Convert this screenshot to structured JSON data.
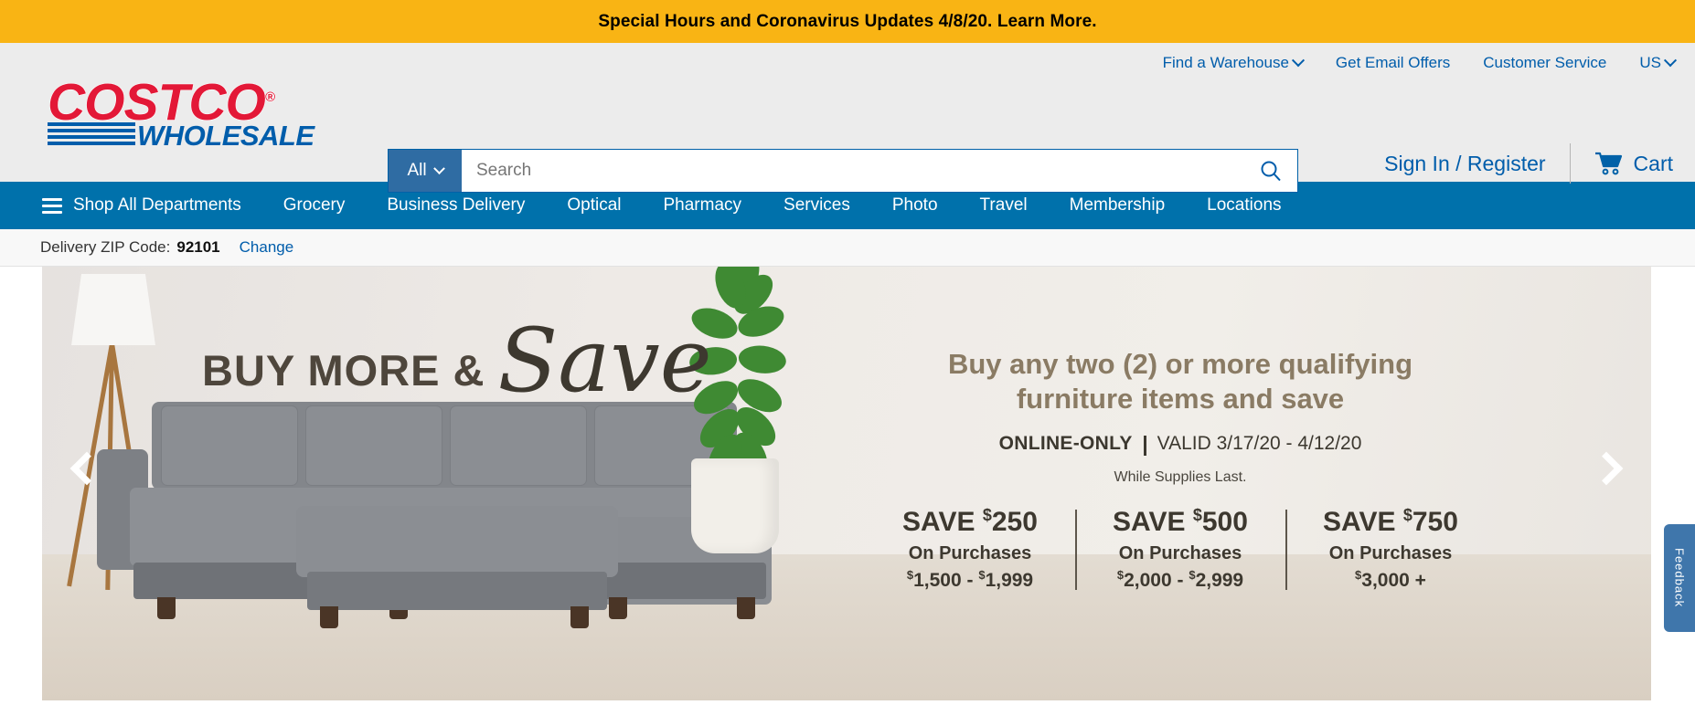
{
  "alert_banner": {
    "text": "Special Hours and Coronavirus Updates 4/8/20. Learn More."
  },
  "header": {
    "logo": {
      "primary": "COSTCO",
      "registered": "®",
      "secondary": "WHOLESALE"
    },
    "top_links": [
      {
        "label": "Find a Warehouse",
        "has_caret": true
      },
      {
        "label": "Get Email Offers",
        "has_caret": false
      },
      {
        "label": "Customer Service",
        "has_caret": false
      },
      {
        "label": "US",
        "has_caret": true
      }
    ],
    "search": {
      "scope": "All",
      "value": "",
      "placeholder": "Search",
      "icon": "search-icon"
    },
    "account": {
      "sign_in": "Sign In / Register",
      "cart_label": "Cart",
      "cart_icon": "shopping-cart-icon"
    }
  },
  "main_nav": {
    "menu_icon": "hamburger-icon",
    "items": [
      {
        "label": "Shop All Departments"
      },
      {
        "label": "Grocery"
      },
      {
        "label": "Business Delivery"
      },
      {
        "label": "Optical"
      },
      {
        "label": "Pharmacy"
      },
      {
        "label": "Services"
      },
      {
        "label": "Photo"
      },
      {
        "label": "Travel"
      },
      {
        "label": "Membership"
      },
      {
        "label": "Locations"
      }
    ]
  },
  "zip_bar": {
    "label": "Delivery ZIP Code:",
    "value": "92101",
    "change_link": "Change"
  },
  "hero": {
    "headline_block": "BUY MORE &",
    "headline_script": "Save",
    "promo_line_1": "Buy any two (2) or more qualifying",
    "promo_line_2": "furniture items and save",
    "online_only": "ONLINE-ONLY",
    "valid": "VALID 3/17/20 - 4/12/20",
    "supplies": "While Supplies Last.",
    "tiers": [
      {
        "save": "SAVE",
        "amount": "250",
        "sub": "On Purchases",
        "range_low": "1,500",
        "range_high": "1,999",
        "separator": " - "
      },
      {
        "save": "SAVE",
        "amount": "500",
        "sub": "On Purchases",
        "range_low": "2,000",
        "range_high": "2,999",
        "separator": " - "
      },
      {
        "save": "SAVE",
        "amount": "750",
        "sub": "On Purchases",
        "range_low": "3,000",
        "range_high": "",
        "separator": " +"
      }
    ],
    "prev_arrow_icon": "chevron-left-icon",
    "next_arrow_icon": "chevron-right-icon"
  },
  "feedback_tab": {
    "label": "Feedback"
  },
  "colors": {
    "alert_yellow": "#f9b414",
    "brand_red": "#e31837",
    "brand_blue": "#005dab",
    "nav_blue": "#0071ab",
    "header_gray": "#ececec"
  }
}
